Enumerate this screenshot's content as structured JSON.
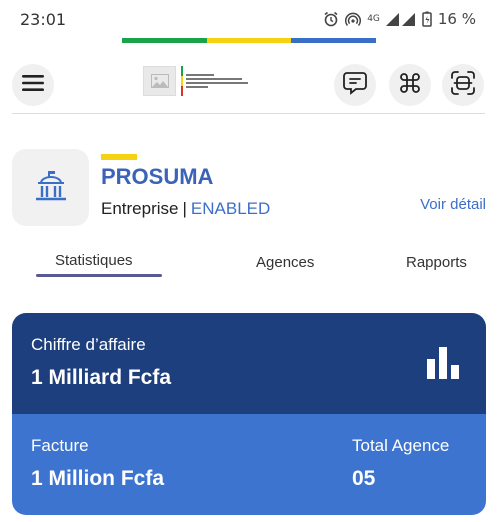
{
  "status_bar": {
    "time": "23:01",
    "network": "4G",
    "battery": "16 %",
    "icons": [
      "alarm-icon",
      "hotspot-icon",
      "signal-icon",
      "battery-icon"
    ]
  },
  "flag_colors": [
    "#1aa34a",
    "#f5d312",
    "#3a6fc7"
  ],
  "header": {
    "icons": [
      "menu-icon",
      "chat-icon",
      "command-icon",
      "scan-icon"
    ]
  },
  "company": {
    "name": "PROSUMA",
    "type": "Entreprise",
    "separator": "|",
    "status": "ENABLED",
    "detail_link": "Voir détail",
    "icon": "building-icon",
    "accent_color": "#f5d312",
    "name_color": "#3b63b8"
  },
  "tabs": [
    {
      "label": "Statistiques",
      "active": true
    },
    {
      "label": "Agences",
      "active": false
    },
    {
      "label": "Rapports",
      "active": false
    }
  ],
  "stats": {
    "revenue_label": "Chiffre d’affaire",
    "revenue_value": "1 Milliard Fcfa",
    "invoice_label": "Facture",
    "invoice_value": "1 Million Fcfa",
    "agencies_label": "Total Agence",
    "agencies_value": "05",
    "top_color": "#1e3f7d",
    "bottom_color": "#3c74cf",
    "icon": "bar-chart-icon"
  }
}
